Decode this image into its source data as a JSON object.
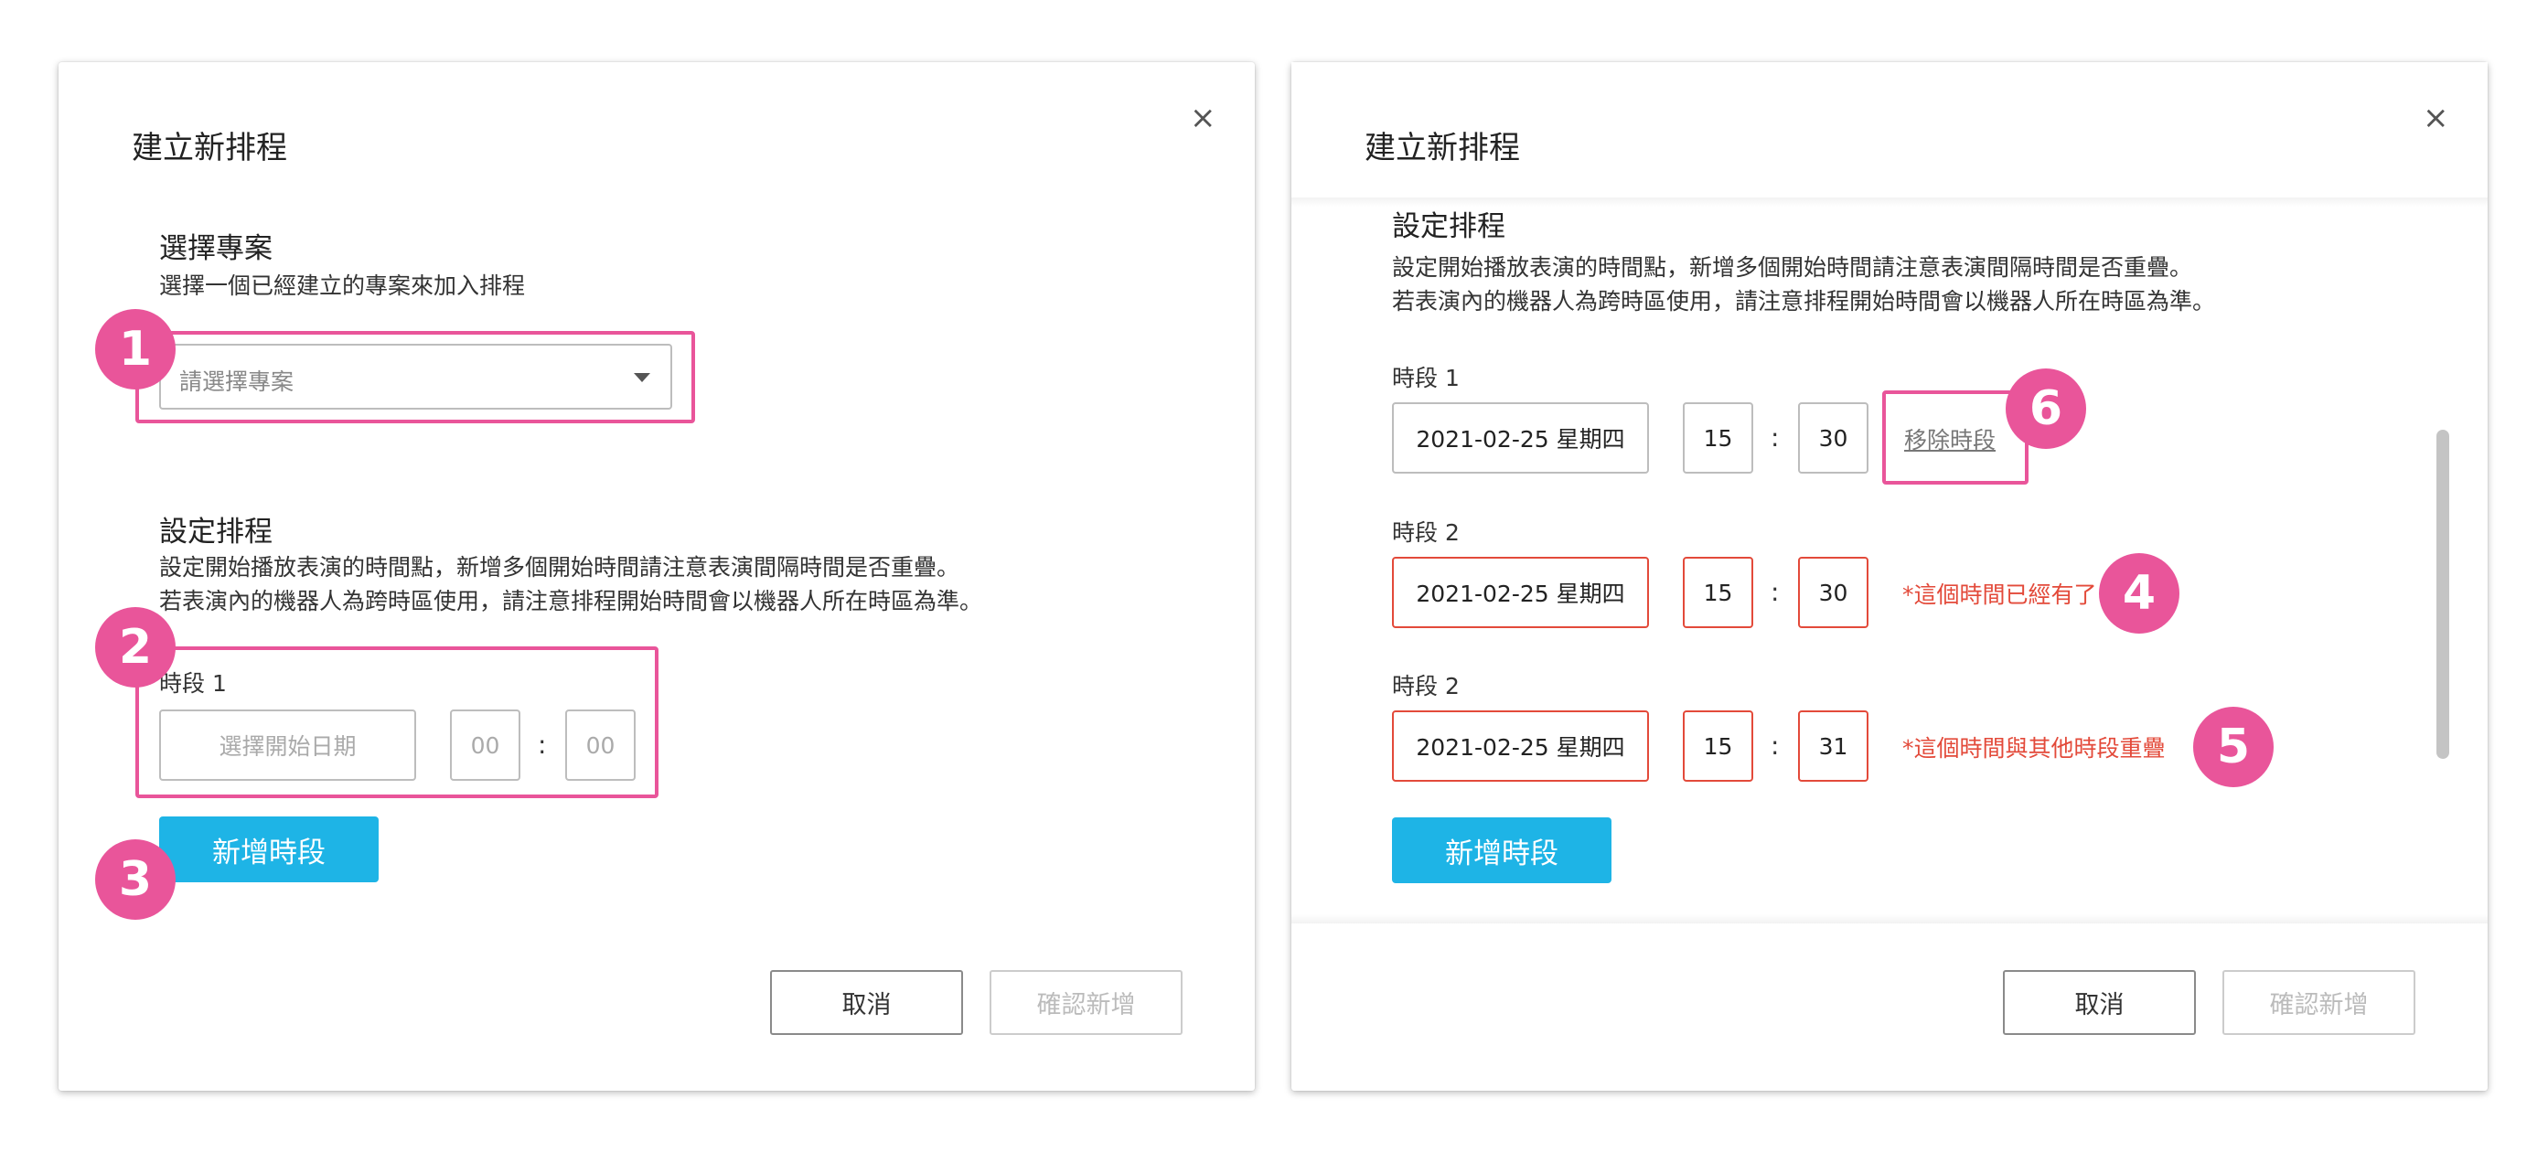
{
  "left_modal": {
    "title": "建立新排程",
    "close_icon": "×",
    "project_section": {
      "title": "選擇專案",
      "description": "選擇一個已經建立的專案來加入排程",
      "select_placeholder": "請選擇專案"
    },
    "schedule_section": {
      "title": "設定排程",
      "description_line1": "設定開始播放表演的時間點，新增多個開始時間請注意表演間隔時間是否重疊。",
      "description_line2": "若表演內的機器人為跨時區使用，請注意排程開始時間會以機器人所在時區為準。",
      "slot_label": "時段 1",
      "date_placeholder": "選擇開始日期",
      "hour_placeholder": "00",
      "minute_placeholder": "00",
      "colon": ":"
    },
    "add_slot_label": "新增時段",
    "cancel_label": "取消",
    "confirm_label": "確認新增",
    "annotations": [
      "1",
      "2",
      "3"
    ]
  },
  "right_modal": {
    "title": "建立新排程",
    "close_icon": "×",
    "schedule_section": {
      "title": "設定排程",
      "description_line1": "設定開始播放表演的時間點，新增多個開始時間請注意表演間隔時間是否重疊。",
      "description_line2": "若表演內的機器人為跨時區使用，請注意排程開始時間會以機器人所在時區為準。"
    },
    "slots": [
      {
        "label": "時段 1",
        "date": "2021-02-25  星期四",
        "hour": "15",
        "minute": "30",
        "action": "移除時段",
        "error": ""
      },
      {
        "label": "時段 2",
        "date": "2021-02-25  星期四",
        "hour": "15",
        "minute": "30",
        "action": "",
        "error": "*這個時間已經有了"
      },
      {
        "label": "時段 2",
        "date": "2021-02-25  星期四",
        "hour": "15",
        "minute": "31",
        "action": "",
        "error": "*這個時間與其他時段重疊"
      }
    ],
    "colon": ":",
    "add_slot_label": "新增時段",
    "cancel_label": "取消",
    "confirm_label": "確認新增",
    "annotations": [
      "6",
      "4",
      "5"
    ]
  },
  "colors": {
    "primary": "#1eb4e6",
    "highlight": "#e9559a",
    "error": "#e34a3a",
    "disabled": "#cccccc"
  },
  "icons": {
    "close": "close-icon",
    "dropdown": "caret-down-icon"
  }
}
